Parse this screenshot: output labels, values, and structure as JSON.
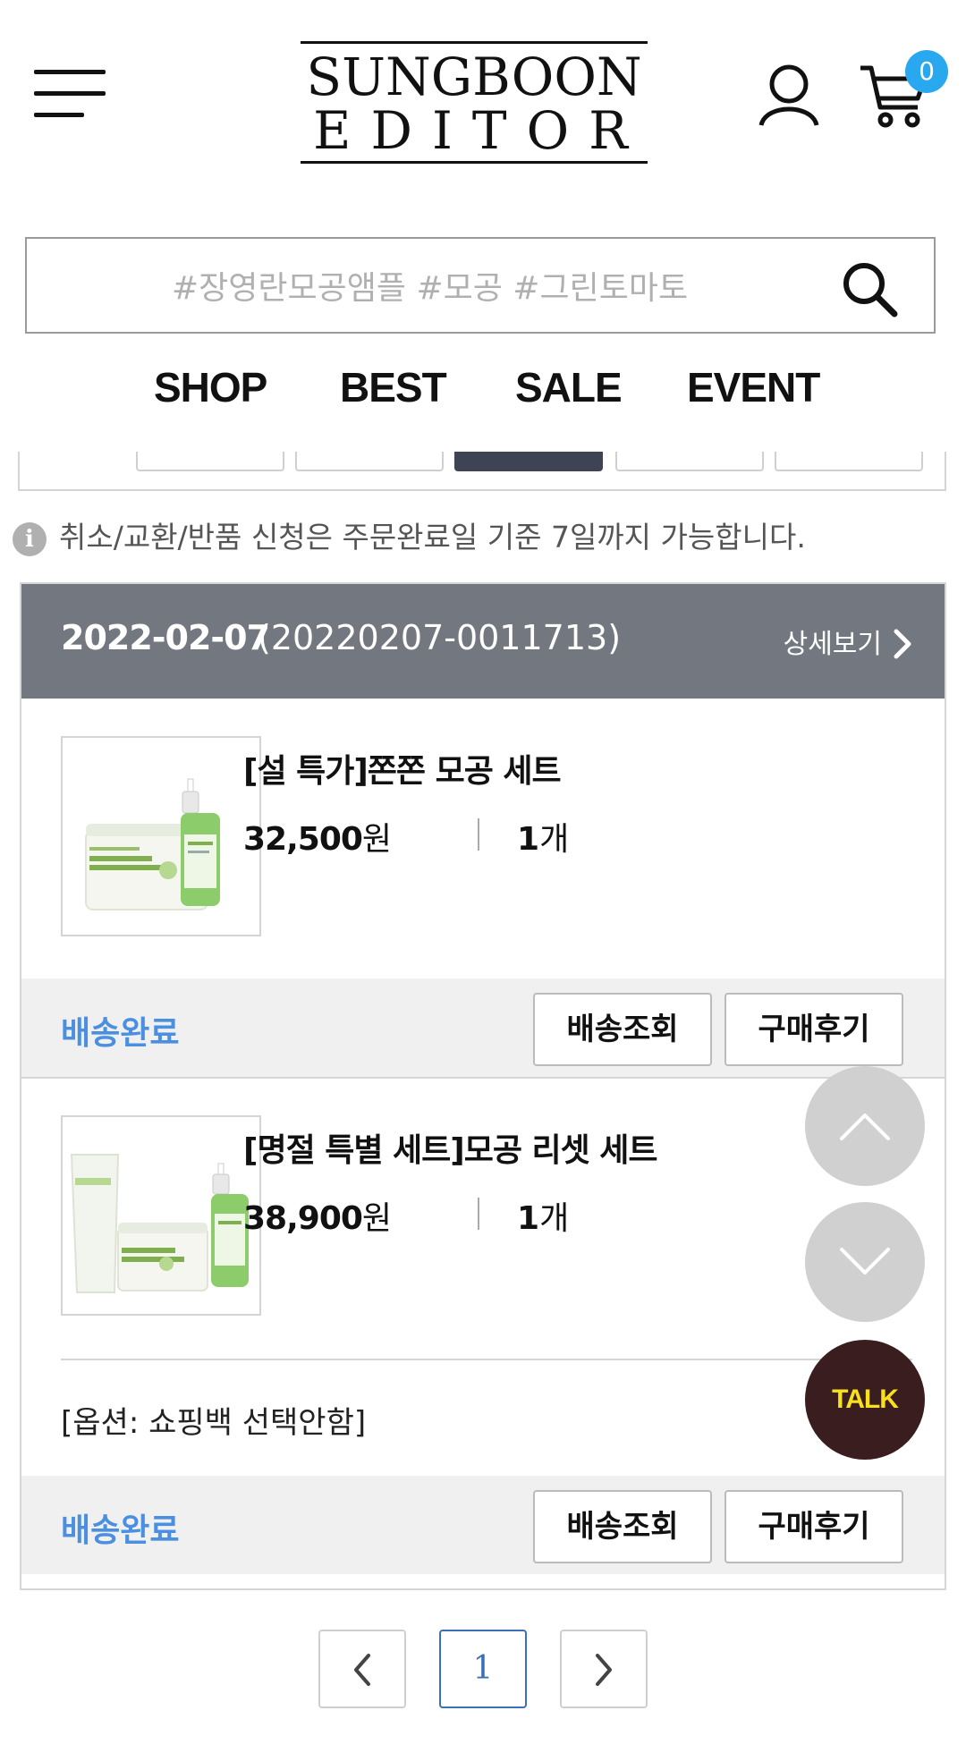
{
  "header": {
    "logo_line1": "SUNGBOON",
    "logo_line2": "EDITOR",
    "cart_count": "0"
  },
  "search": {
    "placeholder": "#장영란모공앰플 #모공 #그린토마토"
  },
  "nav": {
    "items": [
      "SHOP",
      "BEST",
      "SALE",
      "EVENT"
    ]
  },
  "notice": {
    "text": "취소/교환/반품 신청은 주문완료일 기준 7일까지 가능합니다."
  },
  "order": {
    "date": "2022-02-07",
    "number": "(20220207-0011713)",
    "detail_label": "상세보기",
    "items": [
      {
        "name": "[설 특가]쫀쫀 모공 세트",
        "price": "32,500",
        "price_unit": "원",
        "qty": "1",
        "qty_unit": "개",
        "status": "배송완료",
        "track_label": "배송조회",
        "review_label": "구매후기"
      },
      {
        "name": "[명절 특별 세트]모공 리셋 세트",
        "price": "38,900",
        "price_unit": "원",
        "qty": "1",
        "qty_unit": "개",
        "option": "[옵션: 쇼핑백 선택안함]",
        "status": "배송완료",
        "track_label": "배송조회",
        "review_label": "구매후기"
      }
    ]
  },
  "floating": {
    "talk_label": "TALK"
  },
  "pagination": {
    "current_page": "1"
  },
  "colors": {
    "accent_blue": "#4a8fe0",
    "order_header": "#73777f",
    "cart_badge": "#2aa8ef",
    "talk_bg": "#3a1d1f",
    "talk_text": "#f8e11c"
  }
}
